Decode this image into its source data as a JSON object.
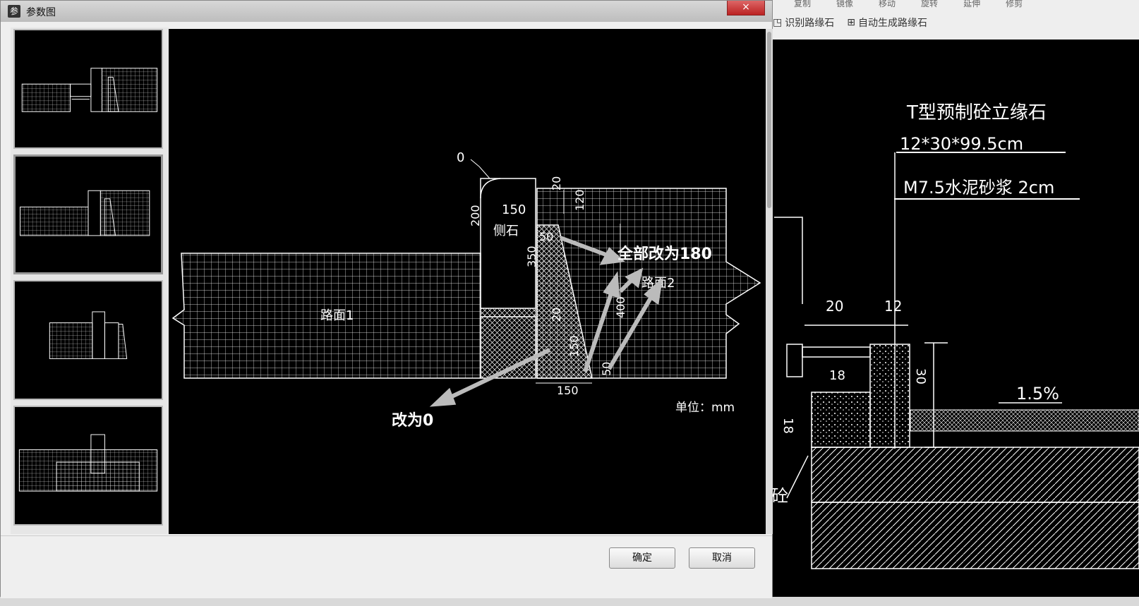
{
  "dialog": {
    "title": "参数图",
    "close_glyph": "×",
    "ok_label": "确定",
    "cancel_label": "取消"
  },
  "app_toolbar": {
    "items": [
      "识别路缘石",
      "自动生成路缘石"
    ],
    "top_items": [
      "复制",
      "镜像",
      "移动",
      "旋转",
      "延伸",
      "修剪"
    ]
  },
  "main_drawing": {
    "label_pavement1": "路面1",
    "label_pavement2": "路面2",
    "label_curb": "侧石",
    "dim_0": "0",
    "dim_200": "200",
    "dim_150_top": "150",
    "dim_350": "350",
    "dim_20_top": "20",
    "dim_120": "120",
    "dim_50_left": "50",
    "dim_20_mid": "20",
    "dim_150_vert": "150",
    "dim_150_bottom": "150",
    "dim_400": "400",
    "dim_50_bottom": "50",
    "annotation_all": "全部改为180",
    "annotation_zero": "改为0",
    "units": "单位：mm"
  },
  "bg_cad": {
    "title": "T型预制砼立缘石",
    "size": "12*30*99.5cm",
    "mortar": "M7.5水泥砂浆 2cm",
    "dim_20": "20",
    "dim_12": "12",
    "dim_18": "18",
    "dim_30": "30",
    "dim_18b": "18",
    "slope": "1.5%",
    "side_char": "砼"
  },
  "colors": {
    "cad_bg": "#000000",
    "cad_line": "#ffffff",
    "dialog_bg": "#efefef"
  }
}
